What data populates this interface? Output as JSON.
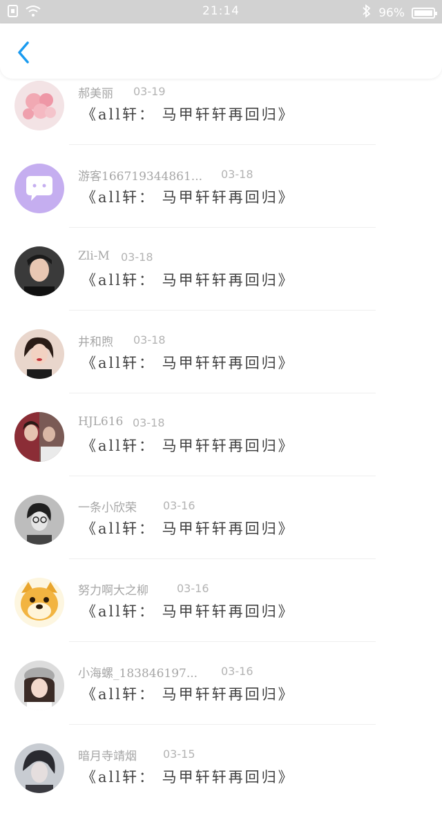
{
  "status_bar": {
    "time": "21:14",
    "battery": "96%",
    "icons": [
      "sim-icon",
      "wifi-icon",
      "bluetooth-icon",
      "battery-icon"
    ]
  },
  "header": {
    "back_icon": "chevron-left-icon",
    "accent": "#1a9bf0"
  },
  "comments": [
    {
      "name": "郝美丽",
      "date": "03-19",
      "title": "《all轩： 马甲轩轩再回归》",
      "avatar": "pink-balloons-avatar"
    },
    {
      "name": "游客166719344861...",
      "date": "03-18",
      "title": "《all轩： 马甲轩轩再回归》",
      "avatar": "chat-bubble-avatar"
    },
    {
      "name": "Zli-M",
      "date": "03-18",
      "title": "《all轩： 马甲轩轩再回归》",
      "avatar": "portrait-avatar"
    },
    {
      "name": "井和煦",
      "date": "03-18",
      "title": "《all轩： 马甲轩轩再回归》",
      "avatar": "portrait-avatar"
    },
    {
      "name": "HJL616",
      "date": "03-18",
      "title": "《all轩： 马甲轩轩再回归》",
      "avatar": "portrait-avatar"
    },
    {
      "name": "一条小欣荣",
      "date": "03-16",
      "title": "《all轩： 马甲轩轩再回归》",
      "avatar": "portrait-avatar"
    },
    {
      "name": "努力啊大之柳",
      "date": "03-16",
      "title": "《all轩： 马甲轩轩再回归》",
      "avatar": "doge-avatar"
    },
    {
      "name": "小海螺_183846197...",
      "date": "03-16",
      "title": "《all轩： 马甲轩轩再回归》",
      "avatar": "portrait-avatar"
    },
    {
      "name": "暗月寺靖烟",
      "date": "03-15",
      "title": "《all轩： 马甲轩轩再回归》",
      "avatar": "portrait-avatar"
    }
  ]
}
